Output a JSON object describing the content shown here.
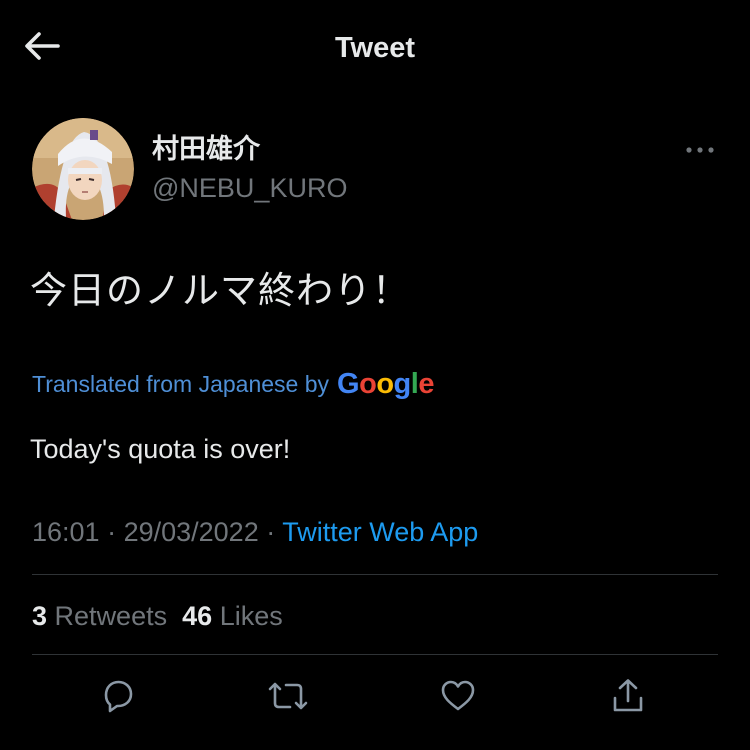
{
  "header": {
    "title": "Tweet",
    "back_icon": "arrow-left-icon"
  },
  "author": {
    "display_name": "村田雄介",
    "handle": "@NEBU_KURO",
    "avatar": "avatar-illustration"
  },
  "more_icon": "more-horizontal-icon",
  "tweet": {
    "text": "今日のノルマ終わり！",
    "translated_label": "Translated from Japanese by",
    "translator_logo": "Google",
    "translation": "Today's quota is over!"
  },
  "meta": {
    "time": "16:01",
    "separator1": " · ",
    "date": "29/03/2022",
    "separator2": " · ",
    "source": "Twitter Web App"
  },
  "stats": {
    "retweets_count": "3",
    "retweets_label": "Retweets",
    "likes_count": "46",
    "likes_label": "Likes"
  },
  "actions": [
    "reply-icon",
    "retweet-icon",
    "like-icon",
    "share-icon"
  ],
  "colors": {
    "background": "#000000",
    "text": "#e7e9ea",
    "secondary": "#71767b",
    "accent": "#1d9bf0",
    "divider": "#2f3336"
  }
}
